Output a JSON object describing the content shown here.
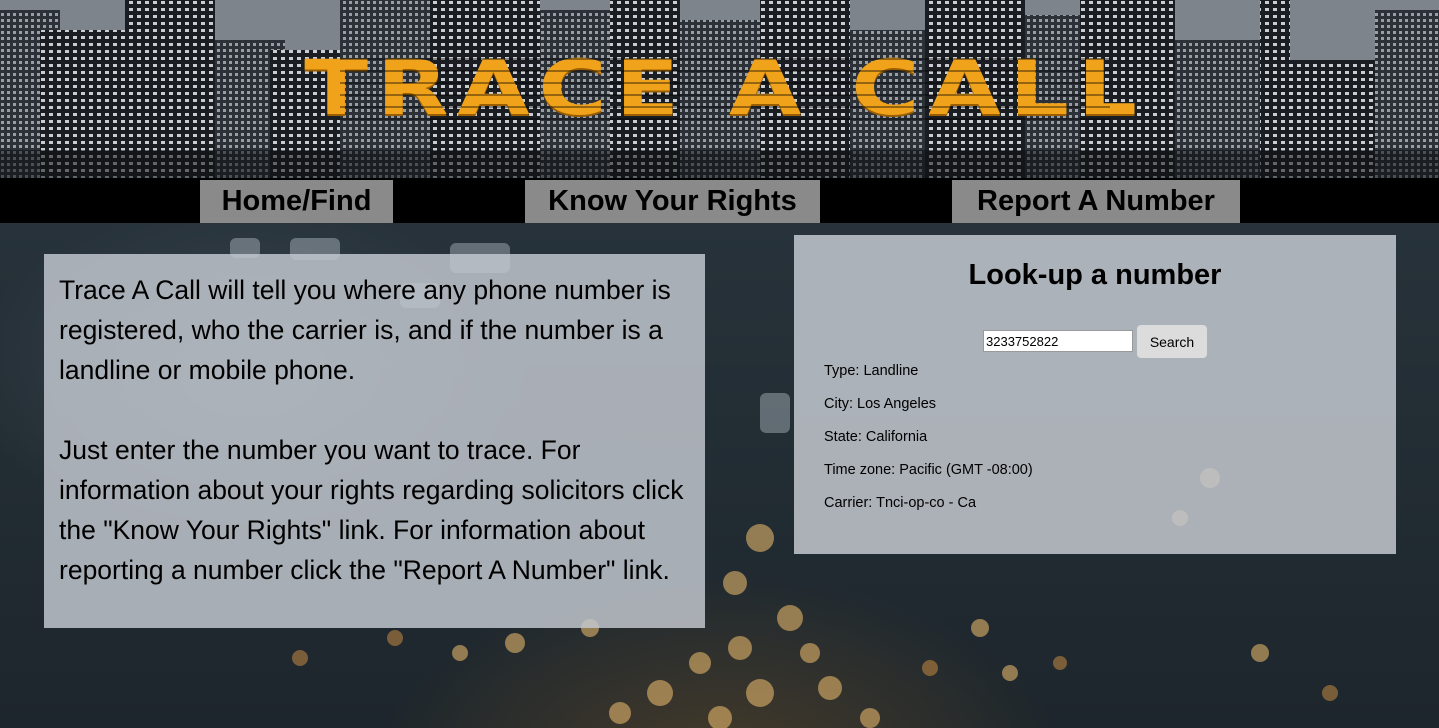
{
  "header": {
    "logo_text": "TRACE A CALL",
    "logo_color": "#f0a21a"
  },
  "nav": {
    "items": [
      {
        "label": "Home/Find"
      },
      {
        "label": "Know Your Rights"
      },
      {
        "label": "Report A Number"
      }
    ]
  },
  "info": {
    "paragraph1": "Trace A Call will tell you where any phone number is registered, who the carrier is, and if the number is a landline or mobile phone.",
    "paragraph2": "Just enter the number you want to trace. For information about your rights regarding solicitors click the \"Know Your Rights\" link. For information about reporting a number click the \"Report A Number\" link."
  },
  "lookup": {
    "title": "Look-up a number",
    "input_value": "3233752822",
    "search_label": "Search",
    "results": [
      "Type: Landline",
      "City: Los Angeles",
      "State: California",
      "Time zone: Pacific (GMT -08:00)",
      "Carrier: Tnci-op-co - Ca"
    ]
  }
}
